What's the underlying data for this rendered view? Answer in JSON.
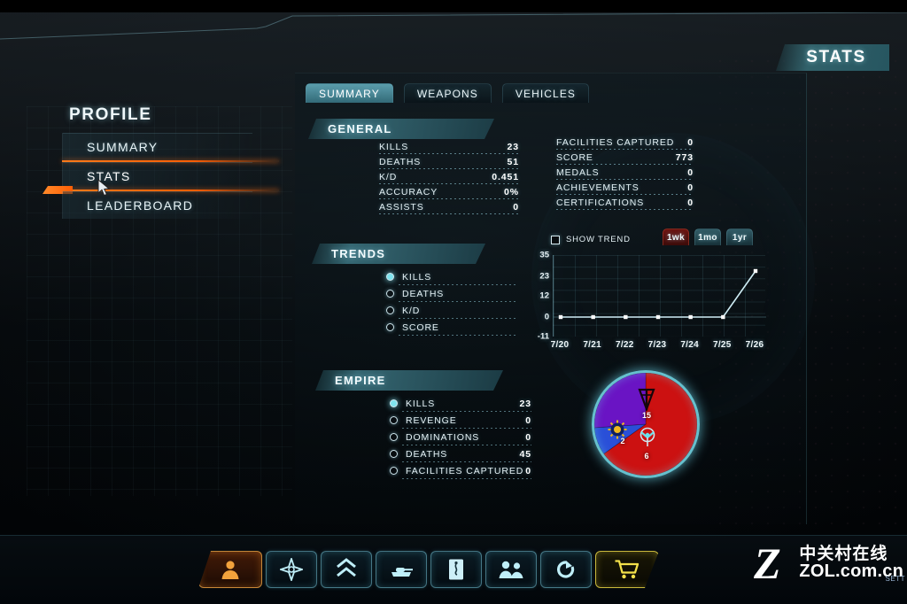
{
  "page": {
    "title": "STATS"
  },
  "sidebar": {
    "header": "PROFILE",
    "items": [
      {
        "label": "SUMMARY",
        "active": false
      },
      {
        "label": "STATS",
        "active": true
      },
      {
        "label": "LEADERBOARD",
        "active": false
      }
    ]
  },
  "tabs": [
    {
      "label": "SUMMARY",
      "active": true
    },
    {
      "label": "WEAPONS",
      "active": false
    },
    {
      "label": "VEHICLES",
      "active": false
    }
  ],
  "general": {
    "header": "GENERAL",
    "left": [
      {
        "label": "KILLS",
        "value": "23"
      },
      {
        "label": "DEATHS",
        "value": "51"
      },
      {
        "label": "K/D",
        "value": "0.451"
      },
      {
        "label": "ACCURACY",
        "value": "0%"
      },
      {
        "label": "ASSISTS",
        "value": "0"
      }
    ],
    "right": [
      {
        "label": "FACILITIES CAPTURED",
        "value": "0"
      },
      {
        "label": "SCORE",
        "value": "773"
      },
      {
        "label": "MEDALS",
        "value": "0"
      },
      {
        "label": "ACHIEVEMENTS",
        "value": "0"
      },
      {
        "label": "CERTIFICATIONS",
        "value": "0"
      }
    ]
  },
  "trends": {
    "header": "TRENDS",
    "options": [
      {
        "label": "KILLS",
        "selected": true
      },
      {
        "label": "DEATHS",
        "selected": false
      },
      {
        "label": "K/D",
        "selected": false
      },
      {
        "label": "SCORE",
        "selected": false
      }
    ],
    "show_trend_label": "SHOW TREND",
    "show_trend_checked": false,
    "periods": [
      {
        "label": "1wk",
        "active": true
      },
      {
        "label": "1mo",
        "active": false
      },
      {
        "label": "1yr",
        "active": false
      }
    ]
  },
  "empire": {
    "header": "EMPIRE",
    "options": [
      {
        "label": "KILLS",
        "value": "23",
        "selected": true
      },
      {
        "label": "REVENGE",
        "value": "0",
        "selected": false
      },
      {
        "label": "DOMINATIONS",
        "value": "0",
        "selected": false
      },
      {
        "label": "DEATHS",
        "value": "45",
        "selected": false
      },
      {
        "label": "FACILITIES CAPTURED",
        "value": "0",
        "selected": false
      }
    ]
  },
  "toolbar": {
    "buttons": [
      {
        "icon": "soldier-profile-icon",
        "active": true
      },
      {
        "icon": "compass-map-icon",
        "active": false
      },
      {
        "icon": "rank-chevron-icon",
        "active": false
      },
      {
        "icon": "tank-vehicle-icon",
        "active": false
      },
      {
        "icon": "document-mission-icon",
        "active": false
      },
      {
        "icon": "squad-people-icon",
        "active": false
      },
      {
        "icon": "power-respawn-icon",
        "active": false
      },
      {
        "icon": "shopping-cart-icon",
        "active": false
      }
    ]
  },
  "watermark": {
    "logo": "Z",
    "chinese": "中关村在线",
    "url": "ZOL.com.cn",
    "corner": "SETT"
  },
  "chart_data": {
    "type": "line",
    "title": "",
    "xlabel": "",
    "ylabel": "",
    "categories": [
      "7/20",
      "7/21",
      "7/22",
      "7/23",
      "7/24",
      "7/25",
      "7/26"
    ],
    "series": [
      {
        "name": "KILLS",
        "values": [
          0,
          0,
          0,
          0,
          0,
          0,
          26
        ]
      }
    ],
    "yticks": [
      35,
      23,
      12,
      0,
      -11
    ],
    "ylim": [
      -11,
      35
    ],
    "grid": true,
    "legend": "none",
    "line_color": "#cfeef6",
    "marker": "square"
  },
  "pie_data": {
    "type": "pie",
    "title": "EMPIRE KILLS",
    "slices": [
      {
        "name": "Terran Republic",
        "value": 15,
        "color": "#cc1111",
        "label": "15"
      },
      {
        "name": "New Conglomerate",
        "value": 2,
        "color": "#2a4fd8",
        "label": "2"
      },
      {
        "name": "Vanu Sovereignty",
        "value": 6,
        "color": "#6a14c4",
        "label": "6"
      }
    ],
    "total": 23
  }
}
